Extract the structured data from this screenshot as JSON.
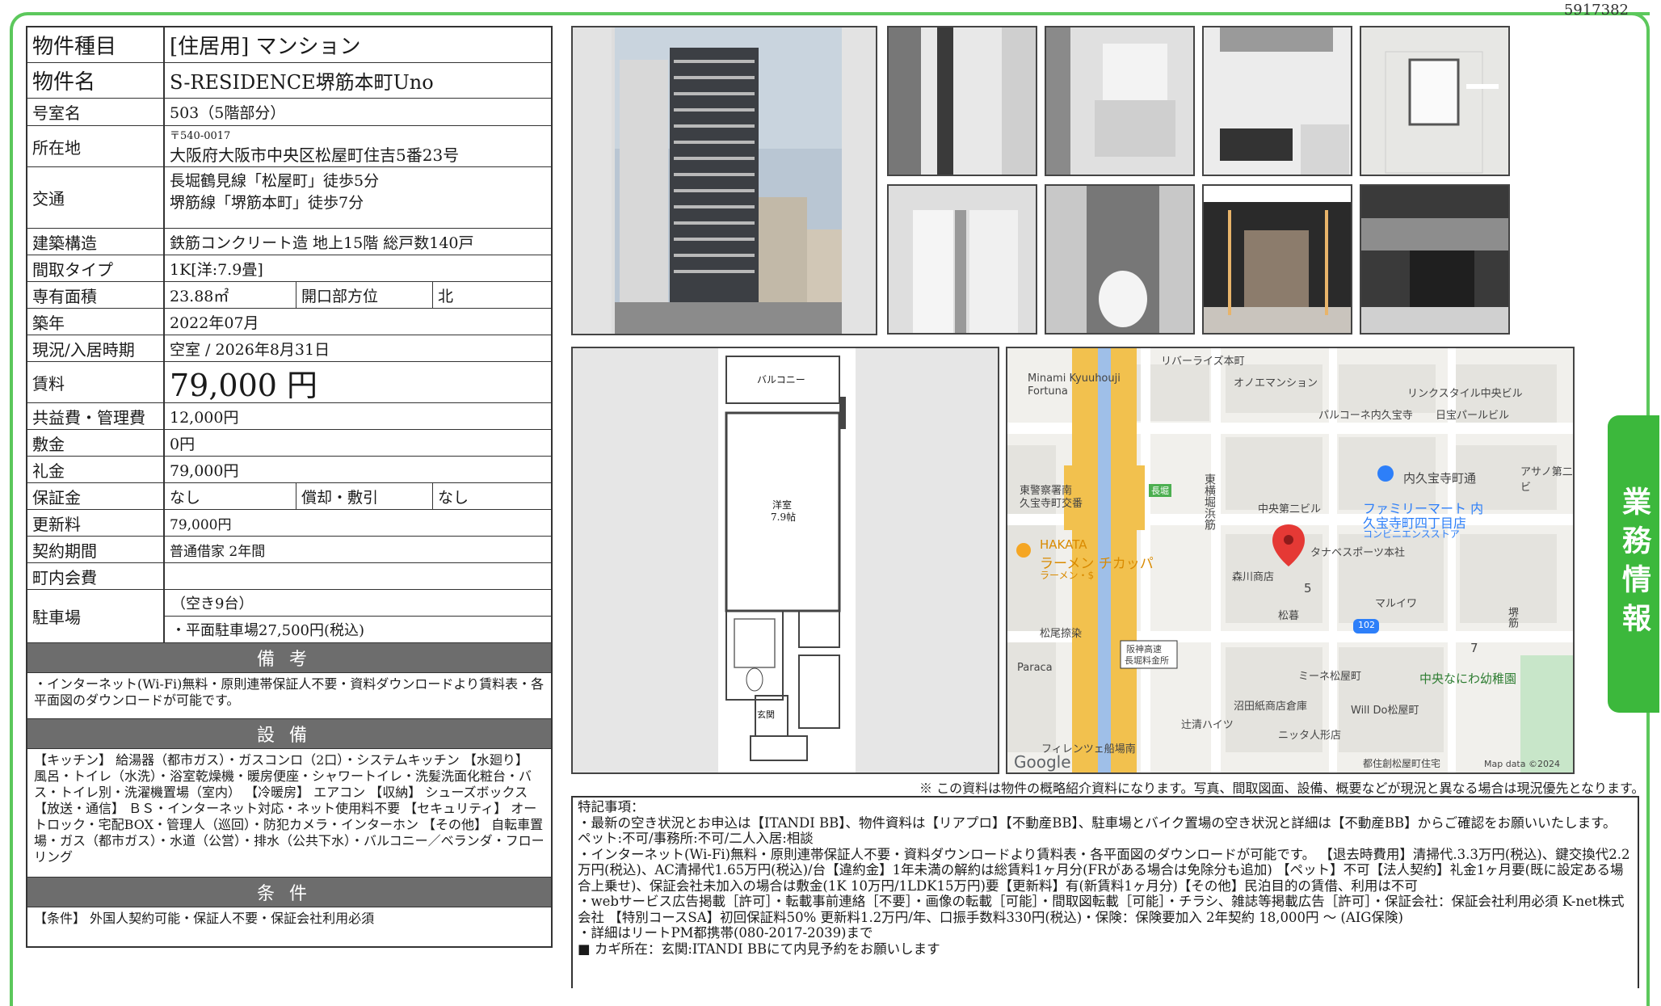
{
  "doc_id": "5917382",
  "side_tab": "業務情報",
  "rows": {
    "type": {
      "label": "物件種目",
      "value": "[住居用] マンション"
    },
    "name": {
      "label": "物件名",
      "value": "S-RESIDENCE堺筋本町Uno"
    },
    "room": {
      "label": "号室名",
      "value": "503（5階部分）"
    },
    "address": {
      "label": "所在地",
      "postal": "〒540-0017",
      "value": "大阪府大阪市中央区松屋町住吉5番23号"
    },
    "transit": {
      "label": "交通",
      "line1": "長堀鶴見線「松屋町」徒歩5分",
      "line2": "堺筋線「堺筋本町」徒歩7分"
    },
    "structure": {
      "label": "建築構造",
      "value": "鉄筋コンクリート造 地上15階 総戸数140戸"
    },
    "layout": {
      "label": "間取タイプ",
      "value": "1K[洋:7.9畳]"
    },
    "area": {
      "label": "専有面積",
      "value": "23.88㎡",
      "sub_label": "開口部方位",
      "sub_value": "北"
    },
    "built": {
      "label": "築年",
      "value": "2022年07月"
    },
    "status": {
      "label": "現況/入居時期",
      "value": "空室 / 2026年8月31日"
    },
    "rent": {
      "label": "賃料",
      "value": "79,000 円"
    },
    "fee": {
      "label": "共益費・管理費",
      "value": "12,000円"
    },
    "deposit": {
      "label": "敷金",
      "value": "0円"
    },
    "key_money": {
      "label": "礼金",
      "value": "79,000円"
    },
    "guarantee": {
      "label": "保証金",
      "value": "なし",
      "sub_label": "償却・敷引",
      "sub_value": "なし"
    },
    "renewal": {
      "label": "更新料",
      "value": "79,000円"
    },
    "contract": {
      "label": "契約期間",
      "value": "普通借家 2年間"
    },
    "town_fee": {
      "label": "町内会費",
      "value": ""
    },
    "parking": {
      "label": "駐車場",
      "line1": "（空き9台）",
      "line2": "・平面駐車場27,500円(税込)"
    }
  },
  "notes_head": "備考",
  "notes": "・インターネット(Wi-Fi)無料・原則連帯保証人不要・資料ダウンロードより賃料表・各平面図のダウンロードが可能です。",
  "equip_head": "設備",
  "equipment": "【キッチン】 給湯器（都市ガス）・ガスコンロ（2口）・システムキッチン 【水廻り】 風呂・トイレ（水洗）・浴室乾燥機・暖房便座・シャワートイレ・洗髪洗面化粧台・バス・トイレ別・洗濯機置場（室内） 【冷暖房】 エアコン 【収納】 シューズボックス 【放送・通信】 ＢＳ・インターネット対応・ネット使用料不要 【セキュリティ】 オートロック・宅配BOX・管理人（巡回）・防犯カメラ・インターホン 【その他】 自転車置場・ガス（都市ガス）・水道（公営）・排水（公共下水）・バルコニー／ベランダ・フローリング",
  "cond_head": "条件",
  "conditions": "【条件】 外国人契約可能・保証人不要・保証会社利用必須",
  "floorplan": {
    "balcony": "バルコニー",
    "room": "洋室",
    "room_size": "7.9帖",
    "entrance": "玄関"
  },
  "map": {
    "labels": [
      "リバーライズ本町",
      "Minami Kyuuhouji",
      "Fortuna",
      "オノエマンション",
      "リンクスタイル中央ビル",
      "パルコーネ内久宝寺",
      "日宝パールビル",
      "内久宝寺町通",
      "アサノ第二ビ",
      "東警察署南",
      "久宝寺町交番",
      "長堀",
      "中央第二ビル",
      "ファミリーマート 内",
      "久宝寺町四丁目店",
      "コンビニエンスストア",
      "HAKATA",
      "ラーメン チカッパ",
      "ラーメン・$",
      "タナベスポーツ本社",
      "森川商店",
      "5",
      "102",
      "マルイワ",
      "松暮",
      "松尾捺染",
      "阪神高速",
      "長堀料金所",
      "Paraca",
      "ミーネ松屋町",
      "中央なにわ幼稚園",
      "7",
      "沼田紙商店倉庫",
      "Will Do松屋町",
      "辻清ハイツ",
      "ニッタ人形店",
      "フィレンツェ船場南",
      "都住創松屋町住宅",
      "東横堀浜筋",
      "堺筋",
      "Google",
      "Map data ©2024"
    ]
  },
  "disclaimer": "※ この資料は物件の概略紹介資料になります。写真、間取図面、設備、概要などが現況と異なる場合は現況優先となります。",
  "remarks": [
    "特記事項：",
    "・最新の空き状況とお申込は【ITANDI BB】、物件資料は【リアプロ】【不動産BB】、駐車場とバイク置場の空き状況と詳細は【不動産BB】からご確認をお願いいたします。",
    "ペット:不可/事務所:不可/二人入居:相談",
    "・インターネット(Wi-Fi)無料・原則連帯保証人不要・資料ダウンロードより賃料表・各平面図のダウンロードが可能です。 【退去時費用】清掃代.3.3万円(税込)、鍵交換代2.2万円(税込)、AC清掃代1.65万円(税込)/台【違約金】1年未満の解約は総賃料1ヶ月分(FRがある場合は免除分も追加) 【ペット】不可【法人契約】礼金1ヶ月要(既に設定ある場合上乗せ)、保証会社未加入の場合は敷金(1K 10万円/1LDK15万円)要【更新料】有(新賃料1ヶ月分)【その他】民泊目的の賃借、利用は不可",
    "・webサービス広告掲載［許可］・転載事前連絡［不要］・画像の転載［可能］・間取図転載［可能］・チラシ、雑誌等掲載広告［許可］・保証会社：保証会社利用必須 K-net株式会社 【特別コースSA】初回保証料50% 更新料1.2万円/年、口振手数料330円(税込)・保険：保険要加入 2年契約 18,000円 ～ (AIG保険)",
    "・詳細はリートPM都携帯(080-2017-2039)まで",
    "■ カギ所在：玄関:ITANDI BBにて内見予約をお願いします"
  ]
}
